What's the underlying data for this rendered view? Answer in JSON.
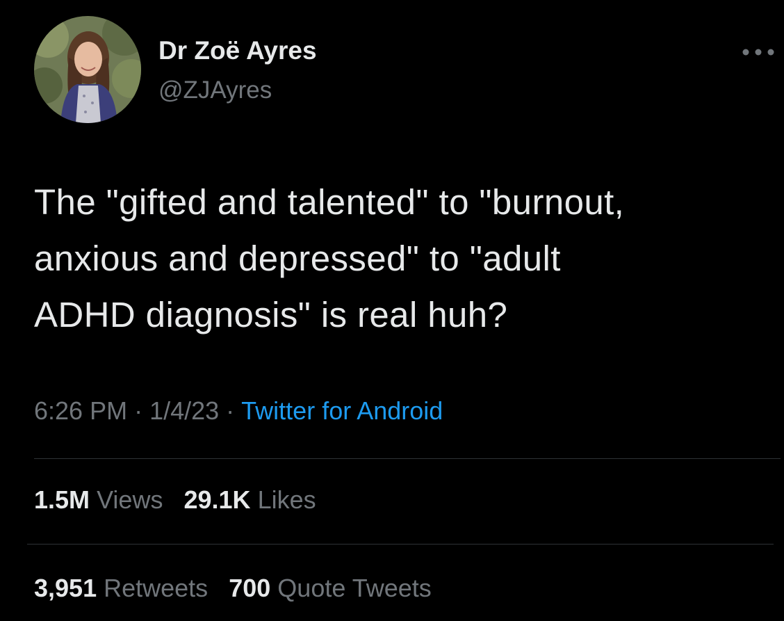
{
  "author": {
    "display_name": "Dr Zoë Ayres",
    "handle": "@ZJAyres",
    "avatar": "profile-photo"
  },
  "more_icon": "more-options-icon",
  "tweet": {
    "text_lines": [
      "The \"gifted and talented\" to \"burnout,",
      "anxious and depressed\" to \"adult",
      "ADHD diagnosis\" is real huh?"
    ]
  },
  "meta": {
    "time": "6:26 PM",
    "separator": "·",
    "date": "1/4/23",
    "source": "Twitter for Android"
  },
  "stats": {
    "views": {
      "count": "1.5M",
      "label": "Views"
    },
    "likes": {
      "count": "29.1K",
      "label": "Likes"
    },
    "retweets": {
      "count": "3,951",
      "label": "Retweets"
    },
    "quotes": {
      "count": "700",
      "label": "Quote Tweets"
    }
  },
  "colors": {
    "background": "#000000",
    "text": "#e7e9ea",
    "secondary": "#71767b",
    "link": "#1d9bf0",
    "divider": "#2f3336"
  }
}
